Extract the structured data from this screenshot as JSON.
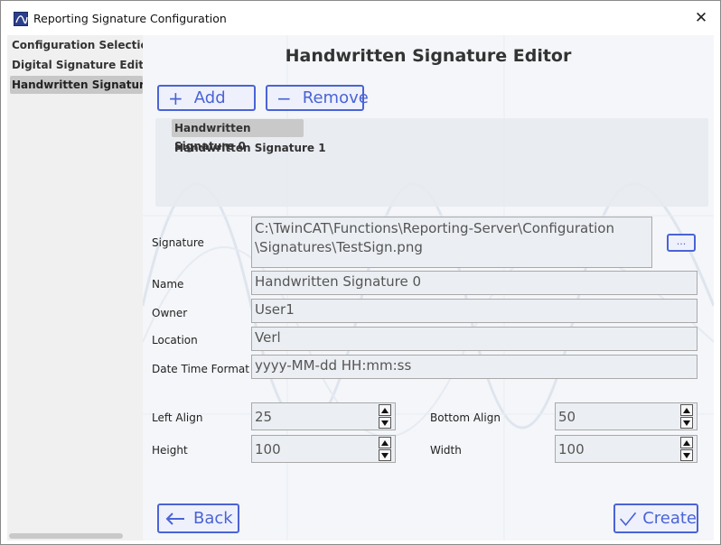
{
  "window": {
    "title": "Reporting Signature Configuration"
  },
  "sidebar": {
    "items": [
      {
        "label": "Configuration Selection"
      },
      {
        "label": "Digital Signature Editor"
      },
      {
        "label": "Handwritten Signature Editor"
      }
    ]
  },
  "main": {
    "title": "Handwritten Signature Editor",
    "add_label": "Add",
    "remove_label": "Remove",
    "signatures": [
      "Handwritten Signature 0",
      "Handwritten Signature 1"
    ],
    "form": {
      "signature_label": "Signature",
      "signature_path_line1": "C:\\TwinCAT\\Functions\\Reporting-Server\\Configuration",
      "signature_path_line2": "\\Signatures\\TestSign.png",
      "browse_label": "...",
      "name_label": "Name",
      "name_value": "Handwritten Signature 0",
      "owner_label": "Owner",
      "owner_value": "User1",
      "location_label": "Location",
      "location_value": "Verl",
      "datetime_label": "Date Time Format",
      "datetime_value": "yyyy-MM-dd HH:mm:ss",
      "left_align_label": "Left Align",
      "left_align_value": "25",
      "bottom_align_label": "Bottom Align",
      "bottom_align_value": "50",
      "height_label": "Height",
      "height_value": "100",
      "width_label": "Width",
      "width_value": "100"
    },
    "back_label": "Back",
    "create_label": "Create"
  },
  "colors": {
    "accent": "#4a63d6",
    "selected": "#c7c7c7"
  }
}
